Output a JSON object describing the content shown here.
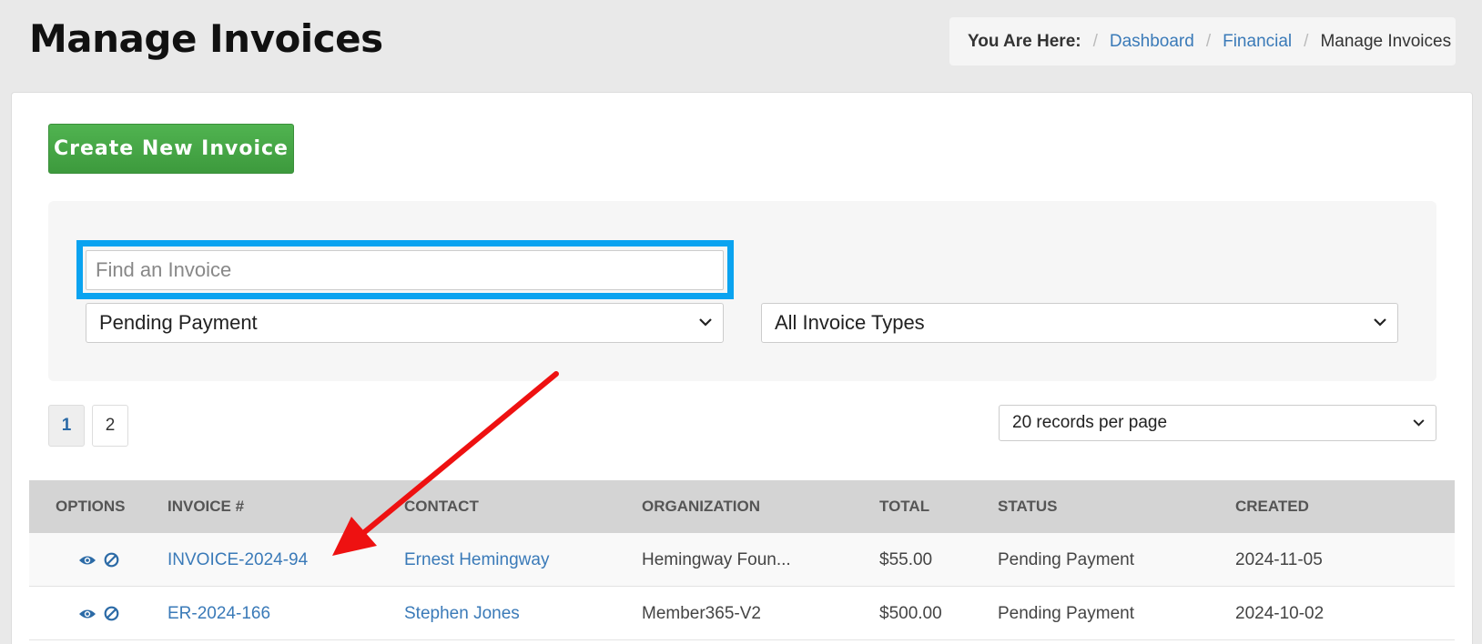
{
  "header": {
    "title": "Manage Invoices"
  },
  "breadcrumb": {
    "lead": "You Are Here:",
    "items": [
      "Dashboard",
      "Financial"
    ],
    "current": "Manage Invoices"
  },
  "actions": {
    "create_label": "Create New Invoice"
  },
  "filters": {
    "search_placeholder": "Find an Invoice",
    "status_selected": "Pending Payment",
    "type_selected": "All Invoice Types"
  },
  "pagination": {
    "pages": [
      "1",
      "2"
    ],
    "active": "1",
    "per_page": "20 records per page"
  },
  "table": {
    "columns": [
      "OPTIONS",
      "INVOICE #",
      "CONTACT",
      "ORGANIZATION",
      "TOTAL",
      "STATUS",
      "CREATED"
    ],
    "rows": [
      {
        "invoice": "INVOICE-2024-94",
        "contact": "Ernest Hemingway",
        "organization": "Hemingway Foun...",
        "total": "$55.00",
        "status": "Pending Payment",
        "created": "2024-11-05"
      },
      {
        "invoice": "ER-2024-166",
        "contact": "Stephen Jones",
        "organization": "Member365-V2",
        "total": "$500.00",
        "status": "Pending Payment",
        "created": "2024-10-02"
      }
    ]
  },
  "colors": {
    "accent": "#3a7ab8",
    "create": "#46a846",
    "highlight": "#0aa3f0",
    "arrow": "#ee1111"
  }
}
